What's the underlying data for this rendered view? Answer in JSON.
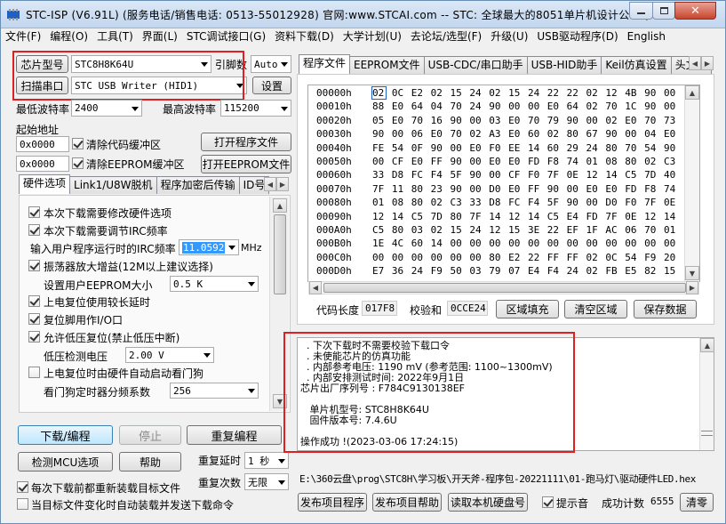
{
  "title": "STC-ISP (V6.91L) (服务电话/销售电话: 0513-55012928) 官网:www.STCAI.com  -- STC: 全球最大的8051单片机设计公司 (...",
  "menu": [
    "文件(F)",
    "编程(O)",
    "工具(T)",
    "界面(L)",
    "STC调试接口(G)",
    "资料下载(D)",
    "大学计划(U)",
    "去论坛/选型(F)",
    "升级(U)",
    "USB驱动程序(D)",
    "English"
  ],
  "left": {
    "chip_type_btn": "芯片型号",
    "chip_value": "STC8H8K64U",
    "pin_label": "引脚数",
    "pin_value": "Auto",
    "scan_btn": "扫描串口",
    "port_value": "STC USB Writer (HID1)",
    "settings_btn": "设置",
    "min_baud_label": "最低波特率",
    "min_baud": "2400",
    "max_baud_label": "最高波特率",
    "max_baud": "115200",
    "start_addr_label": "起始地址",
    "addr1": "0x0000",
    "clear_code": "清除代码缓冲区",
    "open_prog": "打开程序文件",
    "addr2": "0x0000",
    "clear_eeprom": "清除EEPROM缓冲区",
    "open_eeprom": "打开EEPROM文件",
    "tabs": [
      "硬件选项",
      "Link1/U8W脱机",
      "程序加密后传输",
      "ID号"
    ],
    "opt1": "本次下载需要修改硬件选项",
    "opt2": "本次下载需要调节IRC频率",
    "irc_label": "输入用户程序运行时的IRC频率",
    "irc_value": "11.0592",
    "irc_unit": "MHz",
    "opt3": "振荡器放大增益(12M以上建议选择)",
    "eeprom_size_label": "设置用户EEPROM大小",
    "eeprom_size": "0.5 K",
    "opt4": "上电复位使用较长延时",
    "opt5": "复位脚用作I/O口",
    "opt6": "允许低压复位(禁止低压中断)",
    "lv_label": "低压检测电压",
    "lv_value": "2.00 V",
    "opt7": "上电复位时由硬件自动启动看门狗",
    "wdt_label": "看门狗定时器分频系数",
    "wdt_value": "256",
    "download_btn": "下载/编程",
    "stop_btn": "停止",
    "reprogram_btn": "重复编程",
    "detect_btn": "检测MCU选项",
    "help_btn": "帮助",
    "repeat_delay_label": "重复延时",
    "repeat_delay": "1 秒",
    "repeat_count_label": "重复次数",
    "repeat_count": "无限",
    "reload_chk": "每次下载前都重新装载目标文件",
    "auto_chk": "当目标文件变化时自动装载并发送下载命令"
  },
  "right": {
    "tabs": [
      "程序文件",
      "EEPROM文件",
      "USB-CDC/串口助手",
      "USB-HID助手",
      "Keil仿真设置",
      "头文件"
    ],
    "hex_rows": [
      [
        "00000h",
        "02 0C E2 02 15 24 02 15 24 22 22 02 12 4B 90 00"
      ],
      [
        "00010h",
        "88 E0 64 04 70 24 90 00 00 E0 64 02 70 1C 90 00"
      ],
      [
        "00020h",
        "05 E0 70 16 90 00 03 E0 70 79 90 00 02 E0 70 73"
      ],
      [
        "00030h",
        "90 00 06 E0 70 02 A3 E0 60 02 80 67 90 00 04 E0"
      ],
      [
        "00040h",
        "FE 54 0F 90 00 E0 F0 EE 14 60 29 24 80 70 54 90"
      ],
      [
        "00050h",
        "00 CF E0 FF 90 00 E0 E0 FD F8 74 01 08 80 02 C3"
      ],
      [
        "00060h",
        "33 D8 FC F4 5F 90 00 CF F0 7F 0E 12 14 C5 7D 40"
      ],
      [
        "00070h",
        "7F 11 80 23 90 00 D0 E0 FF 90 00 E0 E0 FD F8 74"
      ],
      [
        "00080h",
        "01 08 80 02 C3 33 D8 FC F4 5F 90 00 D0 F0 7F 0E"
      ],
      [
        "00090h",
        "12 14 C5 7D 80 7F 14 12 14 C5 E4 FD 7F 0E 12 14"
      ],
      [
        "000A0h",
        "C5 80 03 02 15 24 12 15 3E 22 EF 1F AC 06 70 01"
      ],
      [
        "000B0h",
        "1E 4C 60 14 00 00 00 00 00 00 00 00 00 00 00 00"
      ],
      [
        "000C0h",
        "00 00 00 00 00 00 80 E2 22 FF FF 02 0C 54 F9 20"
      ],
      [
        "000D0h",
        "E7 36 24 F9 50 03 79 07 E4 F4 24 02 FB E5 82 15"
      ]
    ],
    "code_len_label": "代码长度",
    "code_len": "017F8",
    "checksum_label": "校验和",
    "checksum": "0CCE24",
    "fill_btn": "区域填充",
    "clear_btn": "清空区域",
    "save_btn": "保存数据",
    "info_lines": [
      "  . 下次下载时不需要校验下载口令",
      "  . 未使能芯片的仿真功能",
      "  . 内部参考电压: 1190 mV (参考范围: 1100~1300mV)",
      "  . 内部安排测试时间: 2022年9月1日",
      "芯片出厂序列号 : F784C9130138EF",
      "",
      "   单片机型号: STC8H8K64U",
      "   固件版本号: 7.4.6U",
      "",
      "操作成功 !(2023-03-06 17:24:15)"
    ],
    "file_path": "E:\\360云盘\\prog\\STC8H\\学习板\\开天斧-程序包-20221111\\01-跑马灯\\驱动硬件LED.hex",
    "publish_prog_btn": "发布项目程序",
    "publish_help_btn": "发布项目帮助",
    "read_disk_btn": "读取本机硬盘号",
    "beep_chk": "提示音",
    "success_label": "成功计数",
    "success_count": "6555",
    "clear_count_btn": "清零"
  }
}
